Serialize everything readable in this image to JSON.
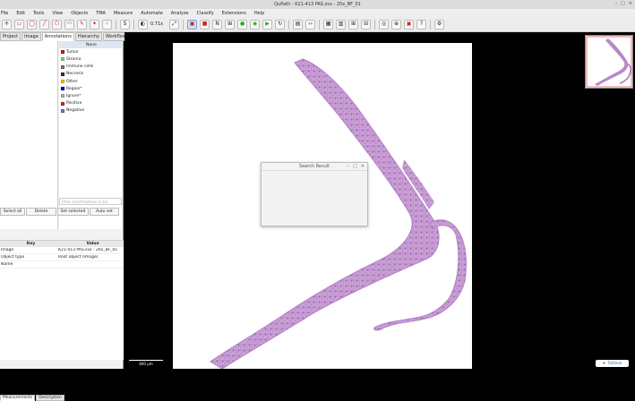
{
  "window": {
    "title": "QuPath - K21-413 PAS.svs - 20x_BF_01",
    "controls": [
      "–",
      "□",
      "✕"
    ]
  },
  "menu": [
    "File",
    "Edit",
    "Tools",
    "View",
    "Objects",
    "TMA",
    "Measure",
    "Automate",
    "Analyze",
    "Classify",
    "Extensions",
    "Help"
  ],
  "toolbar": {
    "tools": [
      {
        "name": "move-icon",
        "glyph": "✛"
      },
      {
        "name": "rectangle-icon",
        "glyph": "▭"
      },
      {
        "name": "ellipse-icon",
        "glyph": "◯"
      },
      {
        "name": "line-icon",
        "glyph": "╱"
      },
      {
        "name": "polygon-icon",
        "glyph": "⬠"
      },
      {
        "name": "polyline-icon",
        "glyph": "〰"
      },
      {
        "name": "brush-icon",
        "glyph": "✎"
      },
      {
        "name": "wand-icon",
        "glyph": "✦"
      },
      {
        "name": "points-icon",
        "glyph": "⁘"
      }
    ],
    "zoom": "0.71x"
  },
  "left_panel": {
    "tabs": [
      "Project",
      "Image",
      "Annotations",
      "Hierarchy",
      "Workflow"
    ],
    "classes": [
      {
        "name": "None",
        "color": "#dde6f2"
      },
      {
        "name": "Tumor",
        "color": "#c81e1e"
      },
      {
        "name": "Stroma",
        "color": "#96c896"
      },
      {
        "name": "Immune cells",
        "color": "#a05aa0"
      },
      {
        "name": "Necrosis",
        "color": "#323232"
      },
      {
        "name": "Other",
        "color": "#ffc800"
      },
      {
        "name": "Region*",
        "color": "#0000b4"
      },
      {
        "name": "Ignore*",
        "color": "#b4b4b4"
      },
      {
        "name": "Positive",
        "color": "#c83232"
      },
      {
        "name": "Negative",
        "color": "#7070e0"
      }
    ],
    "filter_placeholder": "Filter classifications in list",
    "buttons": [
      "Select all",
      "Delete",
      "Set selected",
      "Auto set"
    ],
    "props_header": {
      "key": "Key",
      "value": "Value"
    },
    "props": [
      {
        "key": "Image",
        "value": "K21-413 PAS.svs - 20x_BF_01"
      },
      {
        "key": "Object type",
        "value": "Root object (Image)"
      },
      {
        "key": "Name",
        "value": ""
      }
    ],
    "bottom_tabs": [
      "Measurements",
      "Description"
    ]
  },
  "viewer": {
    "dialog_title": "Search Result",
    "scale_label": "600 µm",
    "toolbox_label": "ToDesk"
  }
}
